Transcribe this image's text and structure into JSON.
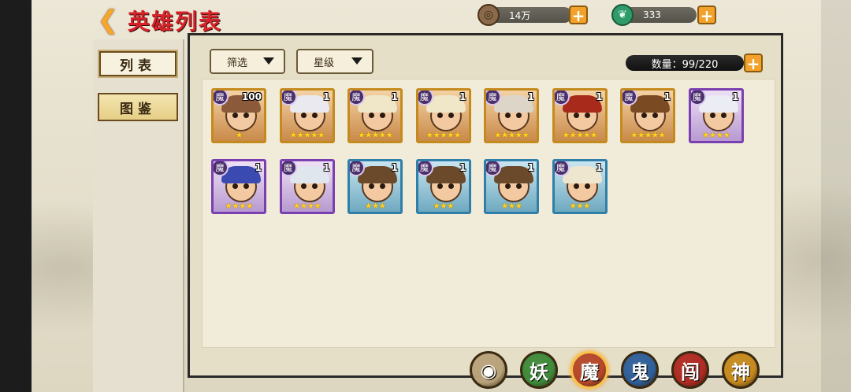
{
  "header": {
    "title": "英雄列表",
    "back_icon": "chevron-left-icon"
  },
  "resources": [
    {
      "icon": "coin-icon",
      "value": "14万"
    },
    {
      "icon": "jade-icon",
      "value": "333"
    }
  ],
  "left_tabs": [
    {
      "label": "列表",
      "active": true
    },
    {
      "label": "图鉴",
      "active": false
    }
  ],
  "filters": {
    "filter_label": "筛选",
    "star_label": "星级"
  },
  "hero_count": "数量：99/220",
  "heroes": [
    {
      "faction": "魔",
      "level": "100",
      "stars": "★",
      "rarity": "gold"
    },
    {
      "faction": "魔",
      "level": "1",
      "stars": "★★★★★",
      "rarity": "gold"
    },
    {
      "faction": "魔",
      "level": "1",
      "stars": "★★★★★",
      "rarity": "gold"
    },
    {
      "faction": "魔",
      "level": "1",
      "stars": "★★★★★",
      "rarity": "gold"
    },
    {
      "faction": "魔",
      "level": "1",
      "stars": "★★★★★",
      "rarity": "gold"
    },
    {
      "faction": "魔",
      "level": "1",
      "stars": "★★★★★",
      "rarity": "gold"
    },
    {
      "faction": "魔",
      "level": "1",
      "stars": "★★★★★",
      "rarity": "gold"
    },
    {
      "faction": "魔",
      "level": "1",
      "stars": "★★★★",
      "rarity": "purple"
    },
    {
      "faction": "魔",
      "level": "1",
      "stars": "★★★★",
      "rarity": "purple"
    },
    {
      "faction": "魔",
      "level": "1",
      "stars": "★★★★",
      "rarity": "purple"
    },
    {
      "faction": "魔",
      "level": "1",
      "stars": "★★★",
      "rarity": "blue"
    },
    {
      "faction": "魔",
      "level": "1",
      "stars": "★★★",
      "rarity": "blue"
    },
    {
      "faction": "魔",
      "level": "1",
      "stars": "★★★",
      "rarity": "blue"
    },
    {
      "faction": "魔",
      "level": "1",
      "stars": "★★★",
      "rarity": "blue"
    }
  ],
  "factions": [
    {
      "label": "",
      "icon": "all-factions-icon",
      "color": "#b8a27a"
    },
    {
      "label": "妖",
      "icon": "yao-icon",
      "color": "#3f8a3a"
    },
    {
      "label": "魔",
      "icon": "mo-icon",
      "color": "#b5472a",
      "selected": true
    },
    {
      "label": "鬼",
      "icon": "gui-icon",
      "color": "#2f5f9a"
    },
    {
      "label": "闯",
      "icon": "chuang-icon",
      "color": "#b02a22"
    },
    {
      "label": "神",
      "icon": "shen-icon",
      "color": "#c58a1e"
    }
  ],
  "colors": {
    "title": "#d7242a",
    "accent": "#f2a22a"
  }
}
